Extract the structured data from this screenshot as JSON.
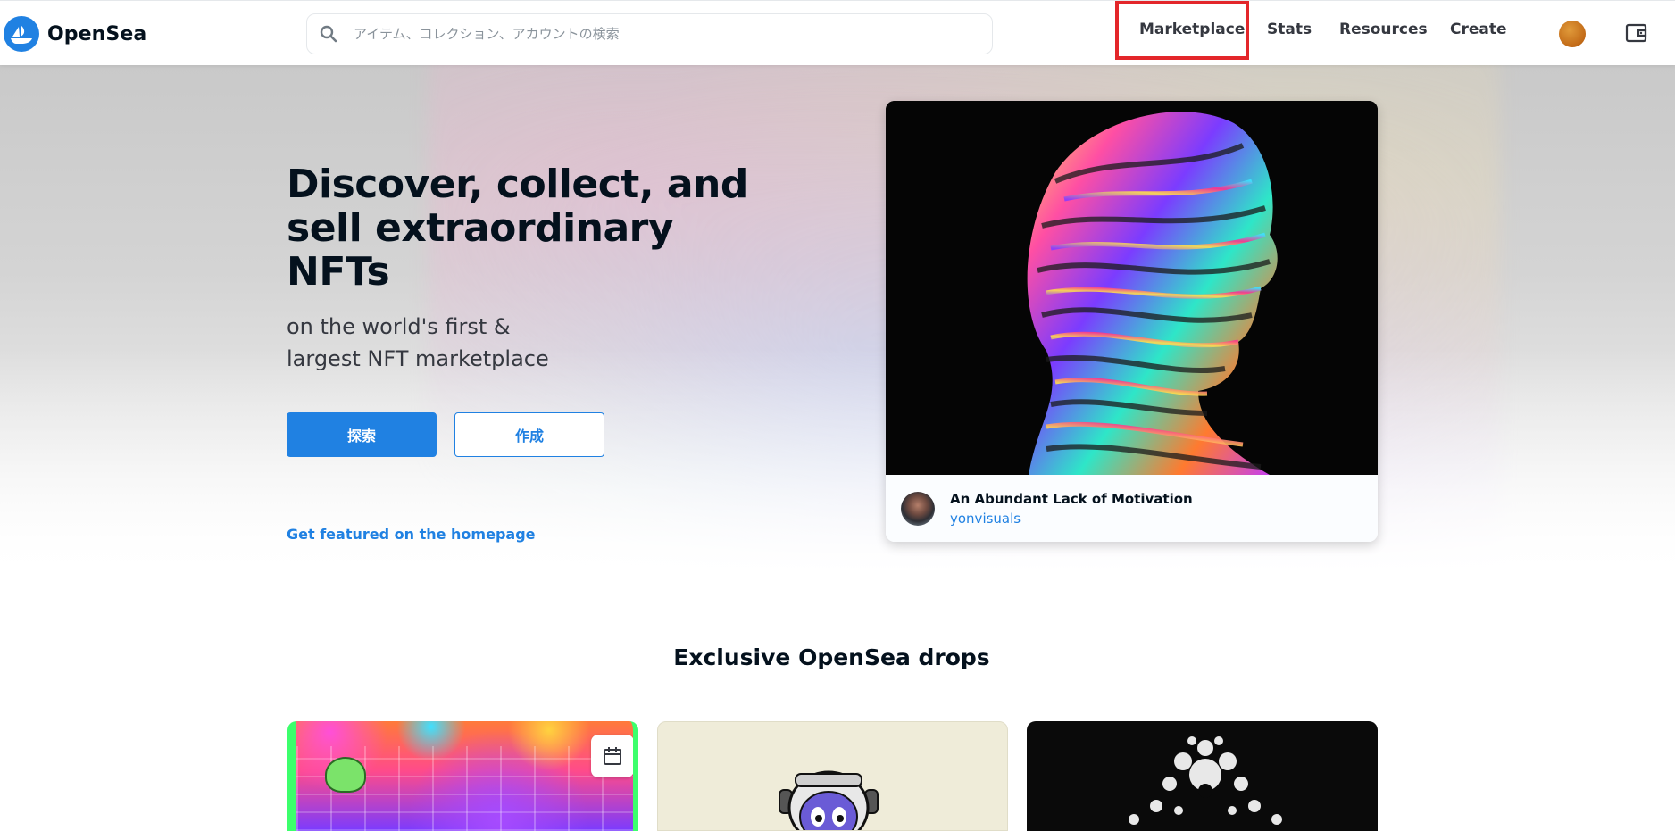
{
  "header": {
    "logo_text": "OpenSea",
    "search_placeholder": "アイテム、コレクション、アカウントの検索",
    "nav": [
      "Marketplace",
      "Stats",
      "Resources",
      "Create"
    ]
  },
  "hero": {
    "title": "Discover, collect, and sell extraordinary NFTs",
    "subtitle": "on the world's first & largest NFT marketplace",
    "explore_button": "探索",
    "create_button": "作成",
    "featured_link": "Get featured on the homepage",
    "featured_nft": {
      "name": "An Abundant Lack of Motivation",
      "creator": "yonvisuals"
    }
  },
  "drops": {
    "title": "Exclusive OpenSea drops"
  },
  "colors": {
    "brand_blue": "#2081e2",
    "highlight_red": "#e3262a"
  }
}
